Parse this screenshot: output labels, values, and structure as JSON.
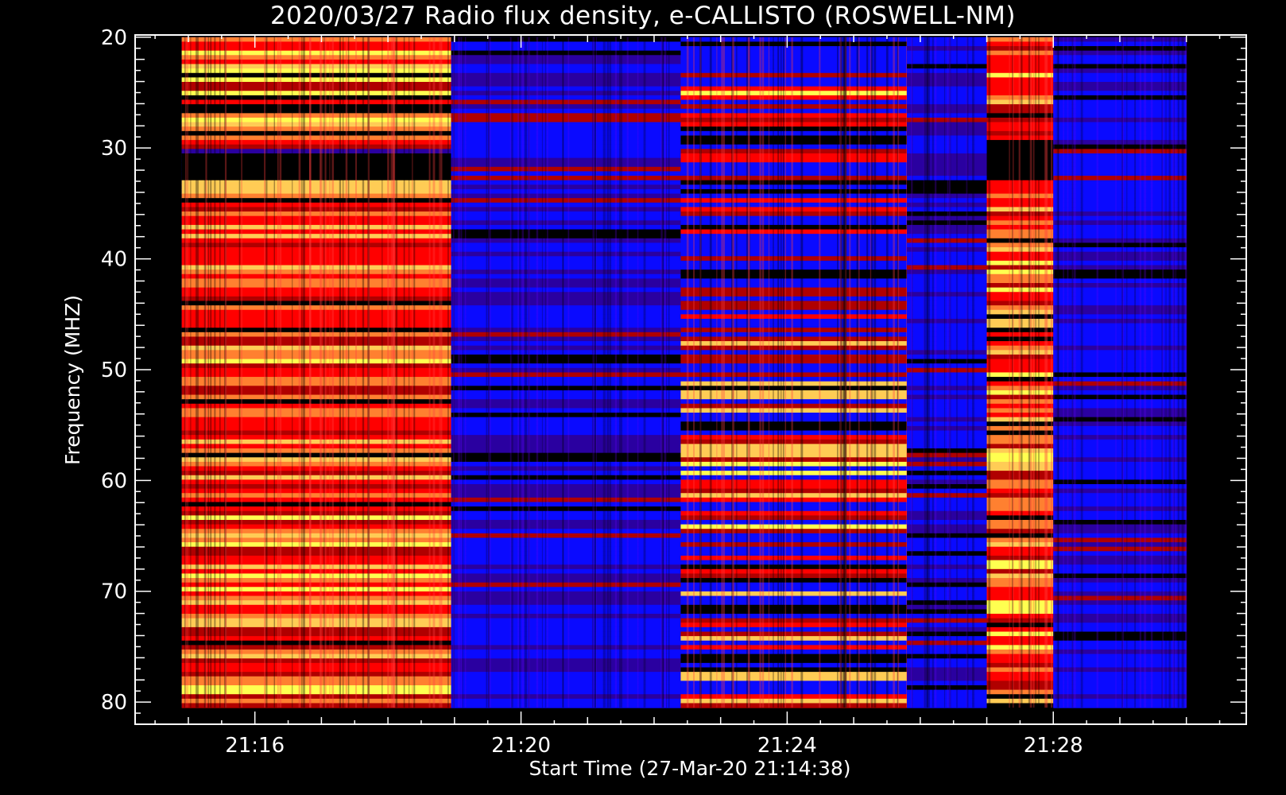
{
  "chart_data": {
    "type": "heatmap",
    "title": "2020/03/27  Radio flux density, e-CALLISTO (ROSWELL-NM)",
    "xlabel": "Start Time (27-Mar-20 21:14:38)",
    "ylabel": "Frequency (MHZ)",
    "x_tick_labels": [
      "21:16",
      "21:20",
      "21:24",
      "21:28"
    ],
    "x_tick_values_minutes": [
      1276,
      1280,
      1284,
      1288
    ],
    "y_tick_labels": [
      "20",
      "30",
      "40",
      "50",
      "60",
      "70",
      "80"
    ],
    "y_tick_values": [
      20,
      30,
      40,
      50,
      60,
      70,
      80
    ],
    "xlim_minutes": [
      1274.2,
      1290.9
    ],
    "ylim": [
      19.8,
      82.0
    ],
    "y_inverted": true,
    "data_extent": {
      "time_start_minutes": 1274.9,
      "time_end_minutes": 1290.0,
      "freq_min": 20.0,
      "freq_max": 80.5
    },
    "intensity_segments": [
      {
        "start_minutes": 1274.9,
        "end_minutes": 1278.95,
        "level": "high",
        "dark_band_mhz": [
          30.0,
          33.0
        ]
      },
      {
        "start_minutes": 1278.95,
        "end_minutes": 1282.4,
        "level": "low"
      },
      {
        "start_minutes": 1282.4,
        "end_minutes": 1285.8,
        "level": "medium"
      },
      {
        "start_minutes": 1285.8,
        "end_minutes": 1287.0,
        "level": "low"
      },
      {
        "start_minutes": 1287.0,
        "end_minutes": 1288.0,
        "level": "high",
        "dark_band_mhz": [
          29.5,
          33.0
        ]
      },
      {
        "start_minutes": 1288.0,
        "end_minutes": 1290.0,
        "level": "low"
      }
    ],
    "colormap": [
      "#000000",
      "#2a00a0",
      "#0a0aff",
      "#b00000",
      "#ff0000",
      "#ff8030",
      "#ffcc55",
      "#ffff50"
    ],
    "grid": false,
    "legend": "none"
  }
}
